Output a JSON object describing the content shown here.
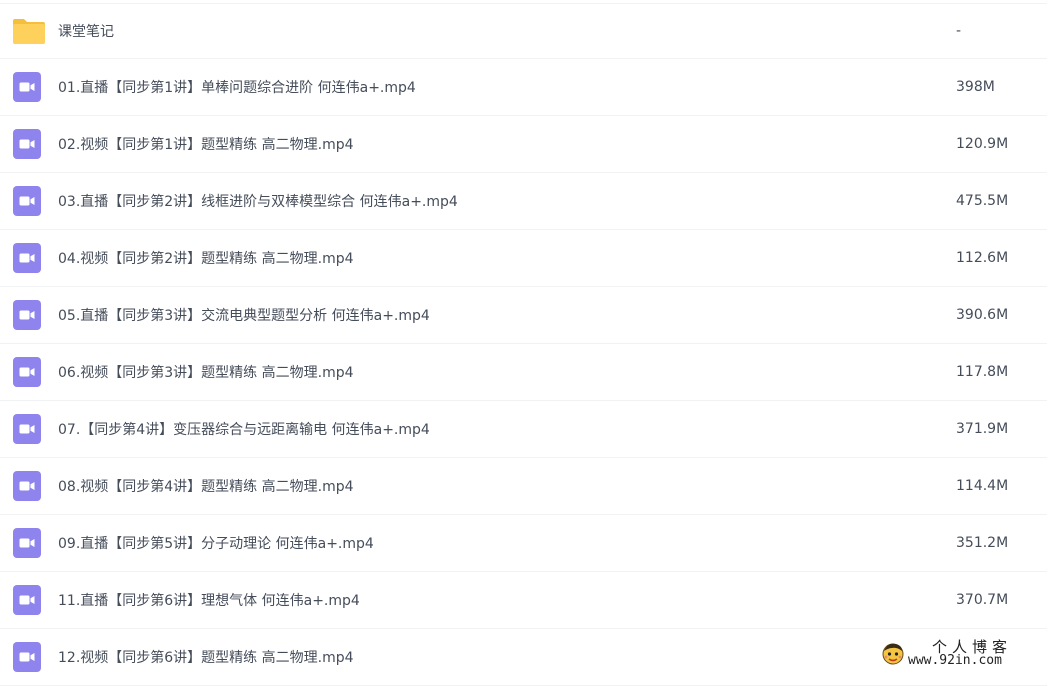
{
  "files": [
    {
      "name": "课堂笔记",
      "size": "-",
      "type": "folder",
      "icon": "folder-icon"
    },
    {
      "name": "01.直播【同步第1讲】单棒问题综合进阶 何连伟a+.mp4",
      "size": "398M",
      "type": "video",
      "icon": "video-file-icon"
    },
    {
      "name": "02.视频【同步第1讲】题型精练 高二物理.mp4",
      "size": "120.9M",
      "type": "video",
      "icon": "video-file-icon"
    },
    {
      "name": "03.直播【同步第2讲】线框进阶与双棒模型综合 何连伟a+.mp4",
      "size": "475.5M",
      "type": "video",
      "icon": "video-file-icon"
    },
    {
      "name": "04.视频【同步第2讲】题型精练 高二物理.mp4",
      "size": "112.6M",
      "type": "video",
      "icon": "video-file-icon"
    },
    {
      "name": "05.直播【同步第3讲】交流电典型题型分析 何连伟a+.mp4",
      "size": "390.6M",
      "type": "video",
      "icon": "video-file-icon"
    },
    {
      "name": "06.视频【同步第3讲】题型精练 高二物理.mp4",
      "size": "117.8M",
      "type": "video",
      "icon": "video-file-icon"
    },
    {
      "name": "07.【同步第4讲】变压器综合与远距离输电 何连伟a+.mp4",
      "size": "371.9M",
      "type": "video",
      "icon": "video-file-icon"
    },
    {
      "name": "08.视频【同步第4讲】题型精练 高二物理.mp4",
      "size": "114.4M",
      "type": "video",
      "icon": "video-file-icon"
    },
    {
      "name": "09.直播【同步第5讲】分子动理论 何连伟a+.mp4",
      "size": "351.2M",
      "type": "video",
      "icon": "video-file-icon"
    },
    {
      "name": "11.直播【同步第6讲】理想气体 何连伟a+.mp4",
      "size": "370.7M",
      "type": "video",
      "icon": "video-file-icon"
    },
    {
      "name": "12.视频【同步第6讲】题型精练 高二物理.mp4",
      "size": "",
      "type": "video",
      "icon": "video-file-icon"
    }
  ],
  "watermark": {
    "title": "个人博客",
    "url": "www.92in.com",
    "icon": "cartoon-face-logo-icon"
  },
  "colors": {
    "folder": "#fdd15c",
    "folder_tab": "#f6bf3b",
    "video": "#8f84ee",
    "divider": "#f1f2f4",
    "text": "#454d5a"
  }
}
